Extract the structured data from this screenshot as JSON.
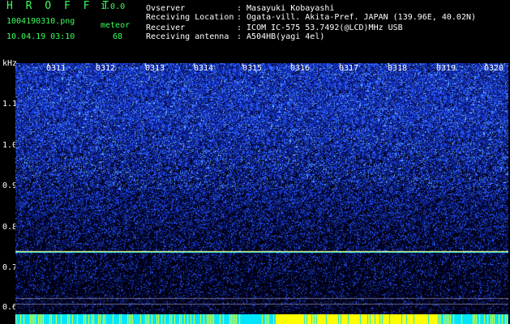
{
  "app": {
    "title_letters": "H R O F F T",
    "version": "1.0.0",
    "file_name": "1004190310.png",
    "mode_label": "meteor",
    "datetime": "10.04.19 03:10",
    "count": "68"
  },
  "info": {
    "rows": [
      {
        "label": "Ovserver",
        "value": ": Masayuki Kobayashi"
      },
      {
        "label": "Receiving Location",
        "value": ": Ogata-vill. Akita-Pref. JAPAN (139.96E, 40.02N)"
      },
      {
        "label": "Receiver",
        "value": ": ICOM IC-575 53.7492(@LCD)MHz USB"
      },
      {
        "label": "Receiving antenna",
        "value": ": A504HB(yagi 4el)"
      }
    ]
  },
  "spectrogram": {
    "y_unit": "kHz",
    "y_ticks": [
      "1.1",
      "1.0",
      "0.9",
      "0.8",
      "0.7",
      "0.6"
    ],
    "time_ticks": [
      "0311",
      "0312",
      "0313",
      "0314",
      "0315",
      "0316",
      "0317",
      "0318",
      "0319",
      "0320"
    ],
    "colors": {
      "background": "#000000",
      "noise_high": "#3a6cff",
      "noise_low": "#0a1a8a",
      "carrier": "#35f0ff",
      "bar_cyan": "#00e5ff",
      "bar_yellow": "#ffff00"
    }
  }
}
